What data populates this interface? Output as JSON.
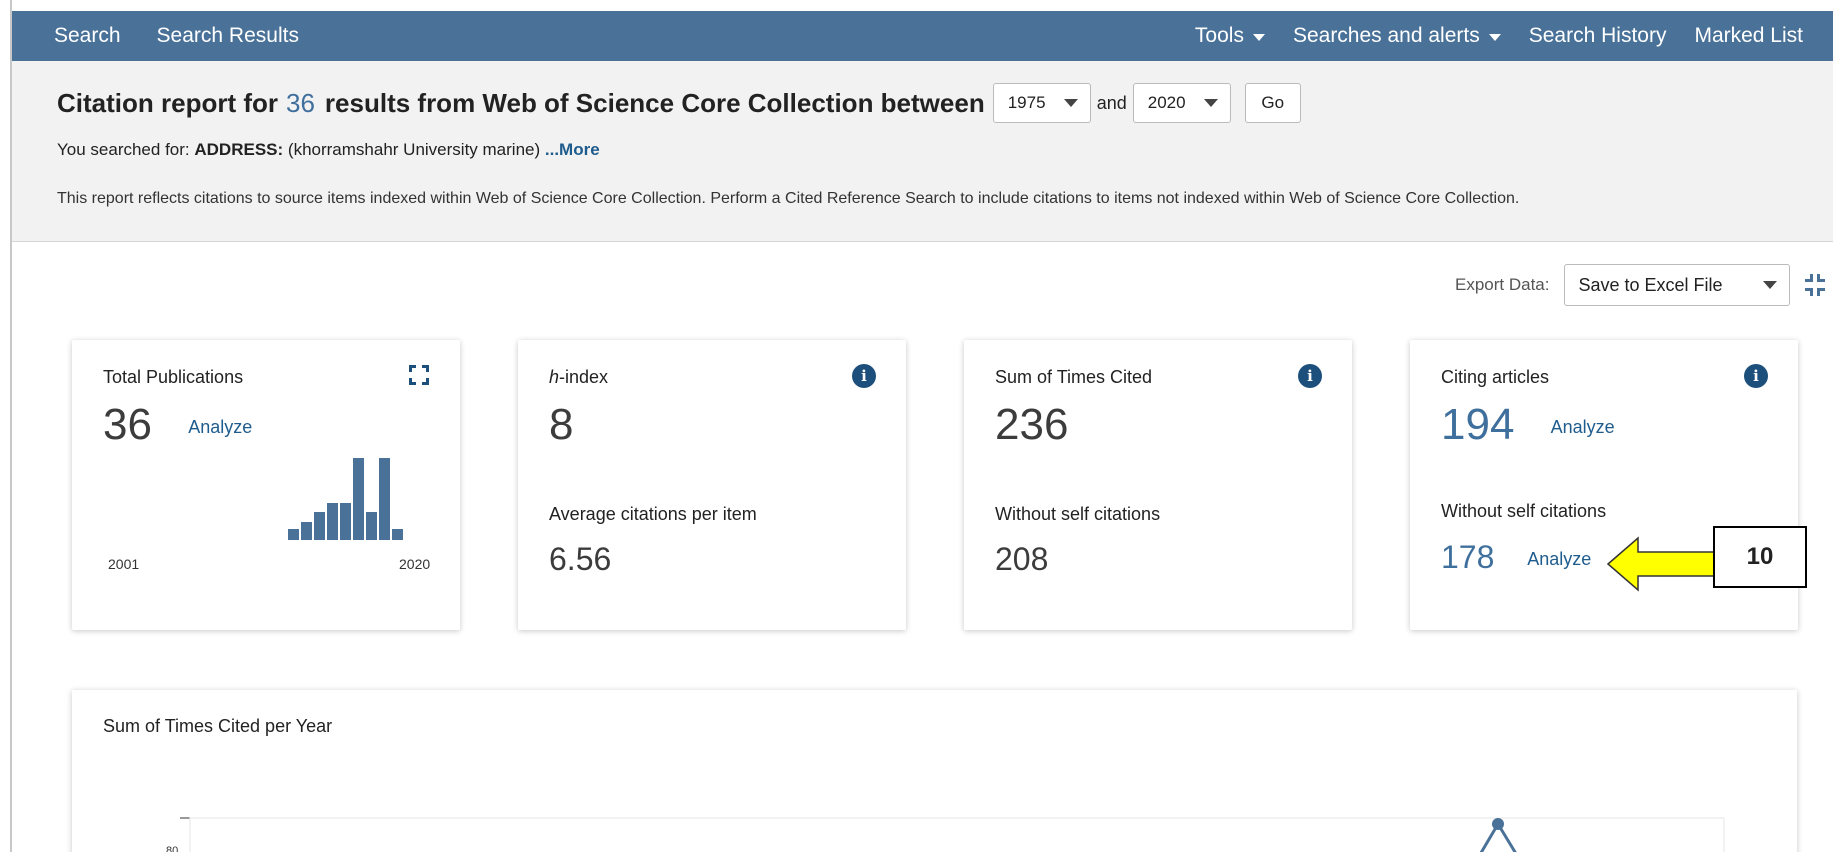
{
  "nav": {
    "search": "Search",
    "search_results": "Search Results",
    "tools": "Tools",
    "searches_alerts": "Searches and alerts",
    "search_history": "Search History",
    "marked_list": "Marked List"
  },
  "report": {
    "title_prefix": "Citation report for",
    "count": "36",
    "title_suffix": "results from Web of Science Core Collection between",
    "year_from": "1975",
    "and_label": "and",
    "year_to": "2020",
    "go_label": "Go",
    "searched_prefix": "You searched for:",
    "searched_field": "ADDRESS:",
    "searched_query": "(khorramshahr University marine)",
    "more_label": "...More",
    "disclaimer": "This report reflects citations to source items indexed within Web of Science Core Collection. Perform a Cited Reference Search to include citations to items not indexed within Web of Science Core Collection."
  },
  "export": {
    "label": "Export Data:",
    "selected": "Save to Excel File"
  },
  "cards": {
    "total_publications": {
      "label": "Total Publications",
      "value": "36",
      "analyze": "Analyze",
      "year_start": "2001",
      "year_end": "2020",
      "histogram": [
        0.13,
        0.22,
        0.34,
        0.45,
        0.45,
        1.0,
        0.34,
        1.0,
        0.13
      ]
    },
    "h_index": {
      "label_italic": "h",
      "label_rest": "-index",
      "value": "8",
      "avg_label": "Average citations per item",
      "avg_value": "6.56"
    },
    "times_cited": {
      "label": "Sum of Times Cited",
      "value": "236",
      "without_label": "Without self citations",
      "without_value": "208"
    },
    "citing_articles": {
      "label": "Citing articles",
      "value": "194",
      "analyze": "Analyze",
      "without_label": "Without self citations",
      "without_value": "178",
      "without_analyze": "Analyze"
    }
  },
  "annotation": {
    "callout_number": "10",
    "arrow_color": "#ffff00"
  },
  "chart_panel": {
    "title": "Sum of Times Cited per Year",
    "y_tick_visible": "80"
  },
  "colors": {
    "nav_bg": "#4a7299",
    "accent": "#3f6f9c",
    "link": "#1f5c8e",
    "info": "#1d4f7c"
  }
}
